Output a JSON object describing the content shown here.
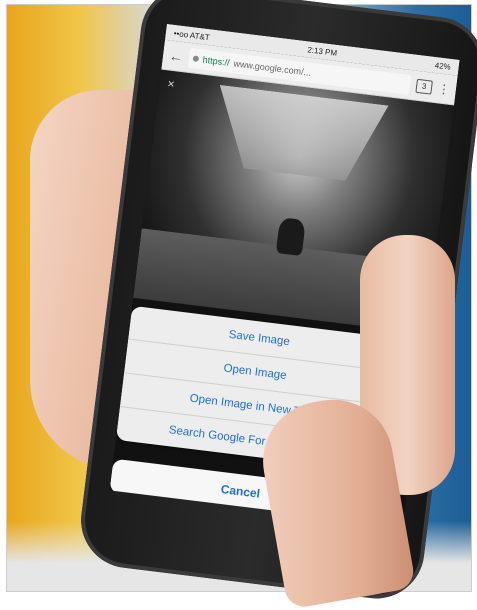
{
  "status_bar": {
    "carrier": "••oo AT&T",
    "time": "2:13 PM",
    "battery": "42%"
  },
  "browser": {
    "back_icon": "arrow-left-icon",
    "url_scheme": "https://",
    "url_host": "www.google.com/...",
    "tab_count": "3",
    "menu_icon": "more-vert-icon"
  },
  "photo": {
    "close_glyph": "×"
  },
  "action_sheet": {
    "items": [
      "Save Image",
      "Open Image",
      "Open Image in New Tab",
      "Search Google For This Image"
    ],
    "cancel_label": "Cancel"
  },
  "colors": {
    "ios_blue": "#1f6fd8",
    "url_scheme_green": "#0b8043"
  }
}
